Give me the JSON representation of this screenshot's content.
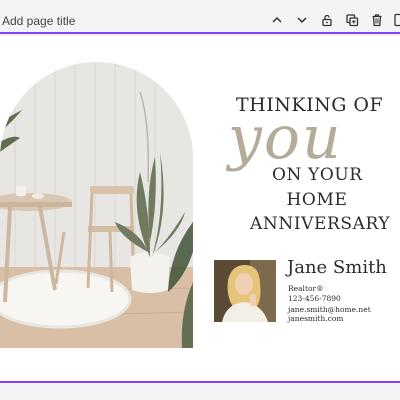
{
  "toolbar": {
    "page_title_placeholder": "Add page title",
    "icons": [
      "chevron-up-icon",
      "chevron-down-icon",
      "lock-icon",
      "duplicate-icon",
      "trash-icon",
      "add-page-icon"
    ]
  },
  "card": {
    "headline_1": "THINKING OF",
    "headline_script": "you",
    "headline_2": "ON YOUR",
    "headline_3": "HOME",
    "headline_4": "ANNIVERSARY"
  },
  "agent": {
    "name": "Jane Smith",
    "title": "Realtor®",
    "phone": "123-456-7890",
    "email": "jane.smith@home.net",
    "website": "janesmith.com"
  },
  "colors": {
    "accent": "#8b3dff",
    "script_text": "#b4ab98",
    "text": "#2e2b29",
    "toolbar_bg": "#f3f4f6"
  }
}
